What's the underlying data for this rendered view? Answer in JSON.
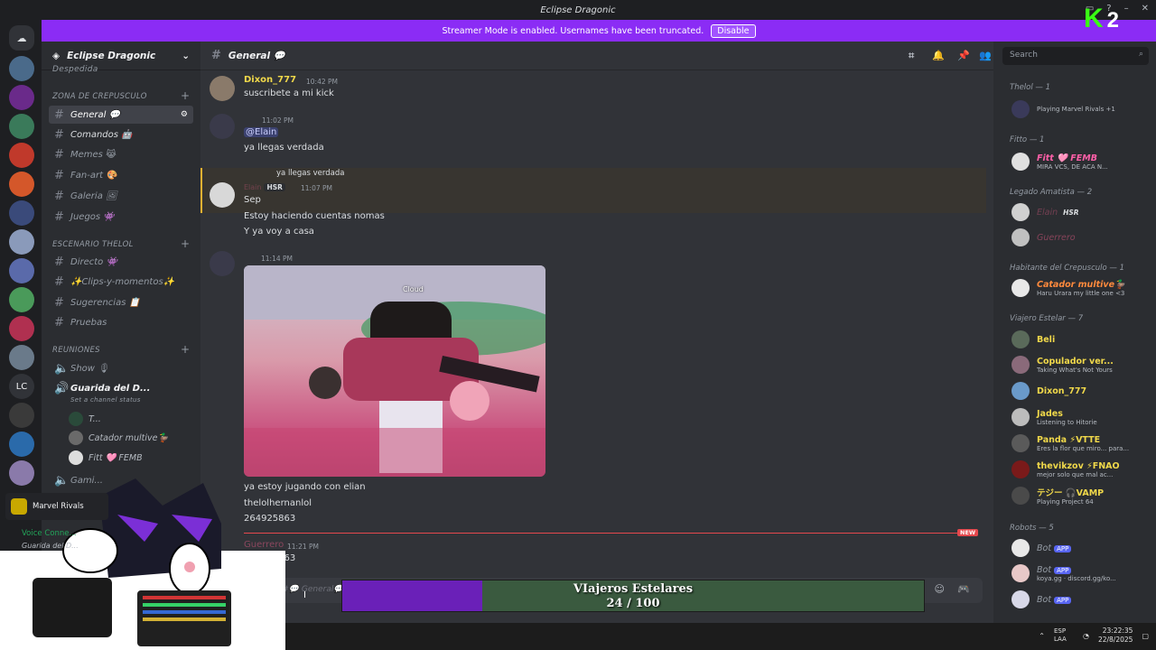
{
  "window": {
    "title": "Eclipse Dragonic"
  },
  "banner": {
    "text": "Streamer Mode is enabled. Usernames have been truncated.",
    "button": "Disable"
  },
  "server": {
    "name": "Eclipse Dragonic",
    "lc": "LC"
  },
  "channels": {
    "top_cut": "Despedida",
    "cat1": "ZONA DE CREPUSCULO",
    "cat2": "ESCENARIO THELOL",
    "cat3": "REUNIONES",
    "items": [
      {
        "label": "General 💬"
      },
      {
        "label": "Comandos 🤖"
      },
      {
        "label": "Memes 😹"
      },
      {
        "label": "Fan-art 🎨"
      },
      {
        "label": "Galeria 🖼"
      },
      {
        "label": "Juegos 👾"
      },
      {
        "label": "Directo 👾"
      },
      {
        "label": "✨Clips-y-momentos✨"
      },
      {
        "label": "Sugerencias 📋"
      },
      {
        "label": "Pruebas"
      }
    ],
    "voice": [
      {
        "label": "Show 🎙"
      },
      {
        "label": "Guarida del D..."
      }
    ],
    "voice_status": "Set a channel status",
    "voice_users": [
      "T...",
      "Catador multive🦆",
      "Fitt 🩷 FEMB"
    ],
    "voice_partial": "Gami..."
  },
  "header": {
    "channel": "General 💬",
    "search": "Search"
  },
  "messages": [
    {
      "name": "Dixon_777",
      "time": "10:42 PM",
      "text": "suscribete a mi kick"
    },
    {
      "time": "11:02 PM",
      "mention": "@Elain",
      "text": "ya llegas verdada"
    },
    {
      "reply": "ya llegas verdada",
      "name": "Elain",
      "tag": "HSR",
      "time": "11:07 PM",
      "lines": [
        "Sep",
        "Estoy haciendo cuentas nomas",
        "Y ya voy a casa"
      ]
    },
    {
      "time": "11:14 PM",
      "image_label": "Cloud",
      "lines": [
        "ya estoy jugando con elian",
        "thelolhernanlol",
        "264925863"
      ]
    },
    {
      "name": "Guerrero",
      "time": "11:21 PM",
      "text": "264925863"
    }
  ],
  "new_tag": "NEW",
  "input": {
    "placeholder": "Message #💬 General💬"
  },
  "members": {
    "g1": "Thelol — 1",
    "g1_sub": "Playing Marvel Rivals +1",
    "g2": "Fitto — 1",
    "g2_name": "Fitt 🩷 FEMB",
    "g2_sub": "MIRA VCS, DE ACA N...",
    "g3": "Legado Amatista — 2",
    "g3a": "Elain",
    "g3a_tag": "HSR",
    "g3b": "Guerrero",
    "g4": "Habitante del Crepusculo — 1",
    "g4_name": "Catador multive🦆",
    "g4_sub": "Haru Urara my little one <3",
    "g5": "Viajero Estelar — 7",
    "g5_members": [
      {
        "name": "Beli",
        "sub": ""
      },
      {
        "name": "Copulador ver...",
        "sub": "Taking What's Not Yours"
      },
      {
        "name": "Dixon_777",
        "sub": ""
      },
      {
        "name": "Jades",
        "sub": "Listening to Hitorie"
      },
      {
        "name": "Panda ⚡VTTE",
        "sub": "Eres la flor que miro... para..."
      },
      {
        "name": "thevikzov ⚡FNAO",
        "sub": "mejor solo que mal ac..."
      },
      {
        "name": "テジー 🎧VAMP",
        "sub": "Playing Project 64"
      }
    ],
    "g6": "Robots — 5",
    "bots": [
      {
        "name": "Bot",
        "tag": "APP",
        "sub": ""
      },
      {
        "name": "Bot",
        "tag": "APP",
        "sub": "koya.gg · discord.gg/ko..."
      },
      {
        "name": "Bot",
        "tag": "APP",
        "sub": ""
      }
    ]
  },
  "overlay": {
    "k": "K",
    "n": "2"
  },
  "voice_connected": {
    "label": "Voice Conne...",
    "sub": "Guarida del D...",
    "game": "Marvel Rivals"
  },
  "progress": {
    "title": "VIajeros Estelares",
    "count": "24 / 100",
    "value": 24,
    "max": 100,
    "fill_color": "#6a20b8",
    "bg_color": "#3a5a3f"
  },
  "taskbar": {
    "lang": "ESP LAA",
    "time": "23:22:35",
    "date": "22/8/2025"
  },
  "colors": {
    "accent": "#8b2cf5",
    "mention_bg": "#3c4270",
    "dixon": "#f0d84a",
    "elain": "#e05a82",
    "guerrero": "#e05a82",
    "role_yellow": "#f0d84a",
    "fitt": "#ff5fa8",
    "catador": "#ff8a3d"
  }
}
